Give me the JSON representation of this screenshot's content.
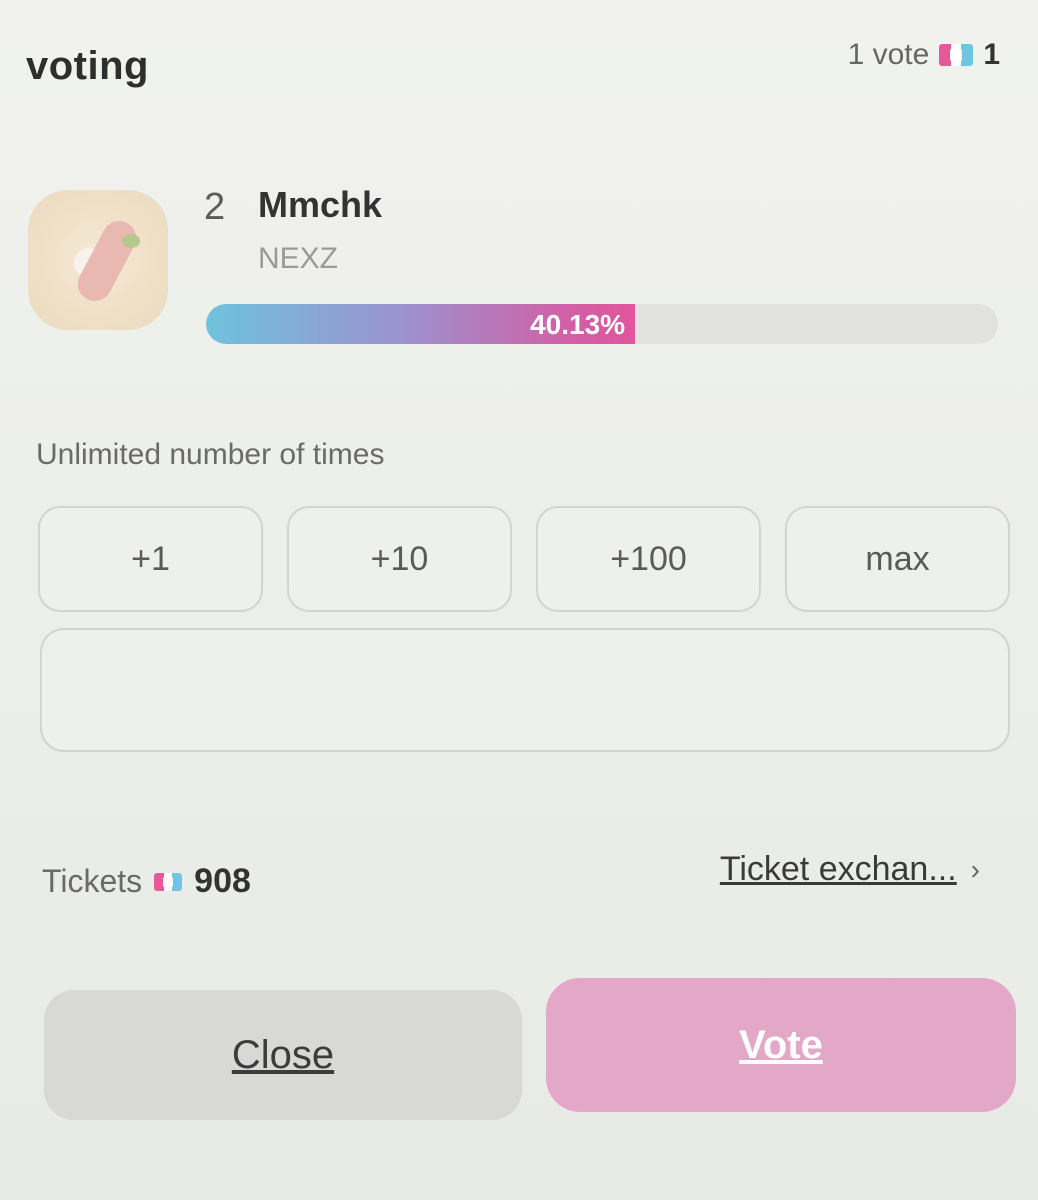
{
  "header": {
    "title": "voting",
    "vote_cost_label": "1 vote",
    "vote_cost_value": "1",
    "ticket_icon": "ticket-icon"
  },
  "candidate": {
    "rank": "2",
    "name": "Mmchk",
    "group": "NEXZ",
    "percent_label": "40.13%",
    "percent_value": 40.13
  },
  "limit_text": "Unlimited number of times",
  "step_buttons": [
    "+1",
    "+10",
    "+100",
    "max"
  ],
  "quantity_input": {
    "value": "",
    "placeholder": ""
  },
  "tickets": {
    "label": "Tickets",
    "count": "908"
  },
  "exchange_link": {
    "label": "Ticket exchan...",
    "icon": "chevron-right-icon"
  },
  "actions": {
    "close_label": "Close",
    "vote_label": "Vote"
  },
  "colors": {
    "accent_pink": "#e0559c",
    "accent_blue": "#6fc2dc",
    "vote_button": "#e3a8c8",
    "close_button": "#d8d9d6"
  }
}
